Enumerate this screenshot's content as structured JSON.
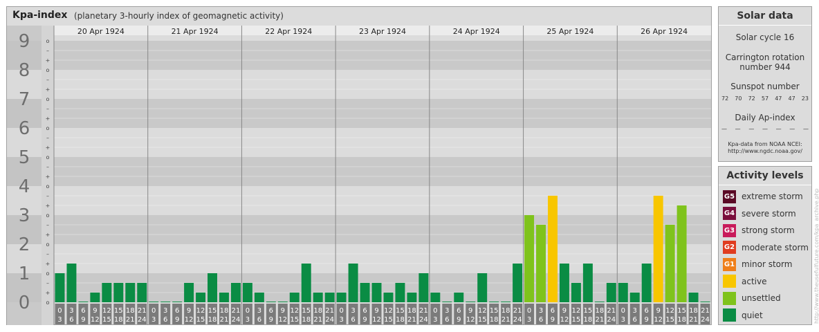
{
  "title": "Kpa-index",
  "subtitle": "(planetary 3-hourly index of geomagnetic activity)",
  "chart_data": {
    "type": "bar",
    "title": "Kpa-index",
    "subtitle": "(planetary 3-hourly index of geomagnetic activity)",
    "ylim": [
      0,
      9
    ],
    "y_ticks": [
      "0",
      "1",
      "2",
      "3",
      "4",
      "5",
      "6",
      "7",
      "8",
      "9"
    ],
    "sub_ticks": [
      "+",
      "o",
      "–"
    ],
    "days": [
      "20 Apr 1924",
      "21 Apr 1924",
      "22 Apr 1924",
      "23 Apr 1924",
      "24 Apr 1924",
      "25 Apr 1924",
      "26 Apr 1924"
    ],
    "interval_labels": [
      {
        "top": "0",
        "bottom": "3"
      },
      {
        "top": "3",
        "bottom": "6"
      },
      {
        "top": "6",
        "bottom": "9"
      },
      {
        "top": "9",
        "bottom": "12"
      },
      {
        "top": "12",
        "bottom": "15"
      },
      {
        "top": "15",
        "bottom": "18"
      },
      {
        "top": "18",
        "bottom": "21"
      },
      {
        "top": "21",
        "bottom": "24"
      }
    ],
    "values": [
      1.0,
      1.333,
      0.0,
      0.333,
      0.667,
      0.667,
      0.667,
      0.667,
      0.0,
      0.0,
      0.0,
      0.667,
      0.333,
      1.0,
      0.333,
      0.667,
      0.667,
      0.333,
      0.0,
      0.0,
      0.333,
      1.333,
      0.333,
      0.333,
      0.333,
      1.333,
      0.667,
      0.667,
      0.333,
      0.667,
      0.333,
      1.0,
      0.333,
      0.0,
      0.333,
      0.0,
      1.0,
      0.0,
      0.0,
      1.333,
      3.0,
      2.667,
      3.667,
      1.333,
      0.667,
      1.333,
      0.0,
      0.667,
      0.667,
      0.333,
      1.333,
      3.667,
      2.667,
      3.333,
      0.333,
      0.0
    ],
    "colors": {
      "quiet": "#0a8c44",
      "unsettled": "#7fc31c",
      "active": "#f8c600",
      "axis_box": "#7b7b7b"
    },
    "grid": true,
    "legend": "right"
  },
  "solar": {
    "title": "Solar data",
    "cycle": "Solar cycle 16",
    "carrington_line1": "Carrington rotation",
    "carrington_line2": "number 944",
    "sunspot_title": "Sunspot number",
    "sunspots": [
      "72",
      "70",
      "72",
      "57",
      "47",
      "47",
      "23"
    ],
    "ap_title": "Daily Ap-index",
    "ap_values": [
      "—",
      "—",
      "—",
      "—",
      "—",
      "—",
      "—"
    ],
    "source_line1": "Kpa-data from NOAA NCEI:",
    "source_line2": "http://www.ngdc.noaa.gov/"
  },
  "activity": {
    "title": "Activity levels",
    "levels": [
      {
        "code": "G5",
        "label": "extreme storm",
        "color": "#5a0a25"
      },
      {
        "code": "G4",
        "label": "severe storm",
        "color": "#7a0e3c"
      },
      {
        "code": "G3",
        "label": "strong storm",
        "color": "#c81a5a"
      },
      {
        "code": "G2",
        "label": "moderate storm",
        "color": "#e03c1f"
      },
      {
        "code": "G1",
        "label": "minor storm",
        "color": "#ef7f1a"
      },
      {
        "code": "",
        "label": "active",
        "color": "#f8c600"
      },
      {
        "code": "",
        "label": "unsettled",
        "color": "#7fc31c"
      },
      {
        "code": "",
        "label": "quiet",
        "color": "#0a8c44"
      }
    ]
  },
  "credit": "http://www.theusefulfuture.com/kpa_archive.php"
}
